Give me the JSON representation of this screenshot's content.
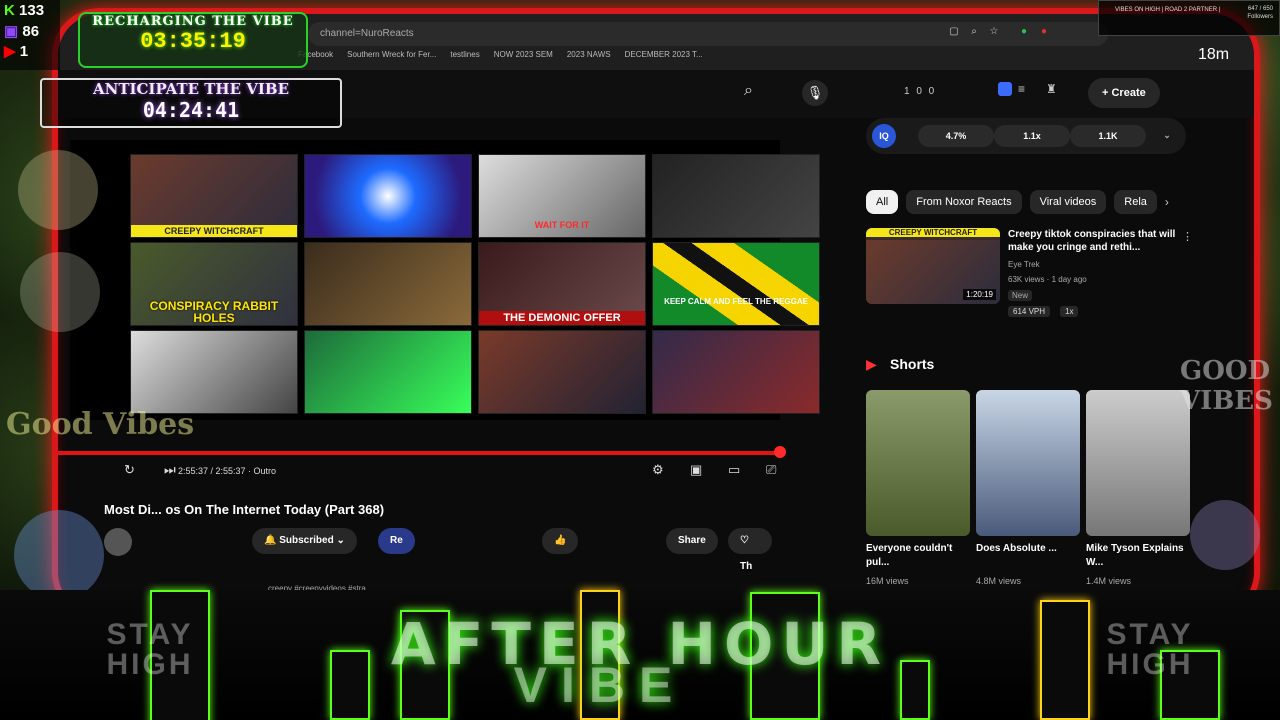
{
  "overlay": {
    "counts": [
      {
        "icon": "kick-icon",
        "value": "133"
      },
      {
        "icon": "twitch-icon",
        "value": "86"
      },
      {
        "icon": "youtube-icon",
        "value": "1"
      }
    ],
    "recharge_title": "RECHARGING THE VIBE",
    "recharge_timer": "03:35:19",
    "anticipate_title": "ANTICIPATE THE VIBE",
    "anticipate_timer": "04:24:41",
    "right_box_label": "VIBES ON HIGH | ROAD 2 PARTNER |",
    "right_box_count": "647 / 650",
    "right_box_sub": "Followers",
    "timer_right": "18m",
    "banner_main": "AFTER HOUR",
    "banner_sub": "VIBE",
    "stay_left": "STAY HIGH",
    "stay_right": "STAY HIGH",
    "good_vibes": "Good Vibes",
    "good_vibes_right": "GOOD VIBES"
  },
  "browser": {
    "url": "channel=NuroReacts",
    "bookmarks": [
      "Facebook",
      "Southern Wreck for Fer...",
      "testlines",
      "NOW 2023 SEM",
      "2023 NAWS",
      "DECEMBER 2023 T..."
    ]
  },
  "youtube": {
    "stats": "1 0 0",
    "create_label": "Create",
    "video_time": "2:55:37 / 2:55:37 · Outro",
    "video_title": "Most Di... os On The Internet Today (Part 368)",
    "subscribed_label": "Subscribed",
    "reacts_label": "Re",
    "share_label": "Share",
    "thanks_label": "Th",
    "description": "creepy #creepyvideos #stra",
    "thumb_captions": [
      "CREEPY WITCHCRAFT",
      "",
      "WAIT FOR IT",
      "",
      "CONSPIRACY RABBIT HOLES",
      "",
      "THE DEMONIC OFFER",
      "KEEP CALM AND FEEL THE REGGAE",
      "",
      "",
      "",
      ""
    ],
    "stat_pills": [
      "4.7%",
      "1.1x",
      "1.1K"
    ],
    "chips": [
      "All",
      "From Noxor Reacts",
      "Viral videos",
      "Rela"
    ],
    "rec": {
      "thumb_caption": "CREEPY WITCHCRAFT",
      "duration": "1:20:19",
      "title": "Creepy tiktok conspiracies that will make you cringe and rethi...",
      "channel": "Eye Trek",
      "views": "63K views · 1 day ago",
      "badge": "New",
      "vph": "614 VPH",
      "mult": "1x"
    },
    "shorts_label": "Shorts",
    "shorts": [
      {
        "title": "Everyone couldn't pul...",
        "views": "16M views"
      },
      {
        "title": "Does Absolute ...",
        "views": "4.8M views"
      },
      {
        "title": "Mike Tyson Explains W...",
        "views": "1.4M views"
      }
    ]
  },
  "colors": {
    "accent_red": "#e21313",
    "neon_green": "#5dff1a",
    "yt_bg": "#0f0f0f"
  }
}
